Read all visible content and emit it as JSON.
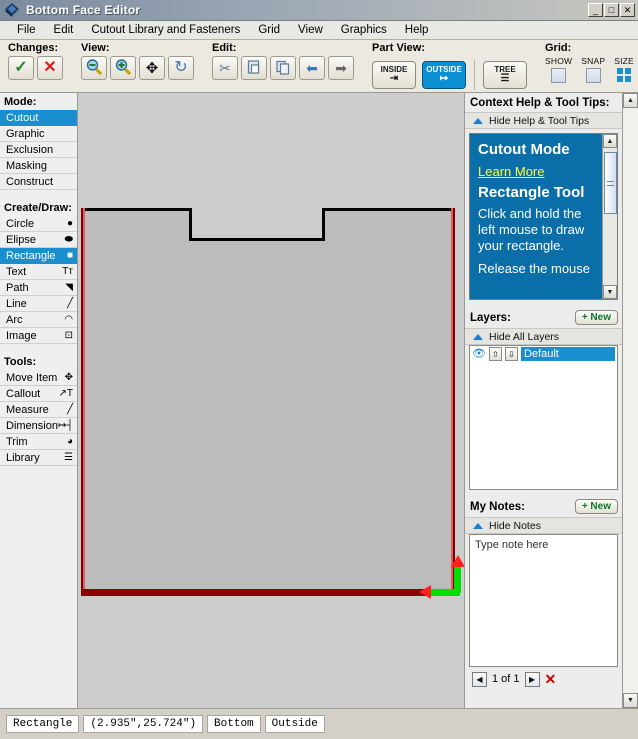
{
  "window": {
    "title": "Bottom Face Editor",
    "icon": "app-diamond-icon",
    "minimize": "_",
    "maximize": "□",
    "close": "✕"
  },
  "menubar": {
    "items": [
      {
        "label": "File"
      },
      {
        "label": "Edit"
      },
      {
        "label": "Cutout Library and Fasteners"
      },
      {
        "label": "Grid"
      },
      {
        "label": "View"
      },
      {
        "label": "Graphics"
      },
      {
        "label": "Help"
      }
    ]
  },
  "toolbar": {
    "changes": {
      "label": "Changes:",
      "accept": "✓",
      "reject": "✕"
    },
    "view": {
      "label": "View:",
      "zoom_out": "zoom-out-icon",
      "zoom_in": "zoom-in-icon",
      "pan": "✥",
      "refresh": "↻"
    },
    "edit": {
      "label": "Edit:",
      "cut": "✂",
      "paste": "paste-icon",
      "copy": "copy-icon",
      "undo": "⬅",
      "redo": "➡"
    },
    "part_view": {
      "label": "Part View:",
      "inside": "INSIDE",
      "inside_glyph": "⇥",
      "outside": "OUTSIDE",
      "outside_glyph": "↦",
      "active": "OUTSIDE",
      "tree": "TREE",
      "tree_glyph": "☰"
    },
    "grid": {
      "label": "Grid:",
      "show": "SHOW",
      "snap": "SNAP",
      "size": "SIZE",
      "show_checked": false,
      "snap_checked": false
    }
  },
  "left_panel": {
    "mode": {
      "label": "Mode:",
      "selected": "Cutout",
      "items": [
        {
          "label": "Cutout",
          "glyph": ""
        },
        {
          "label": "Graphic",
          "glyph": ""
        },
        {
          "label": "Exclusion",
          "glyph": ""
        },
        {
          "label": "Masking",
          "glyph": ""
        },
        {
          "label": "Construct",
          "glyph": ""
        }
      ]
    },
    "create_draw": {
      "label": "Create/Draw:",
      "selected": "Rectangle",
      "items": [
        {
          "label": "Circle",
          "glyph": "●"
        },
        {
          "label": "Elipse",
          "glyph": "⬬"
        },
        {
          "label": "Rectangle",
          "glyph": "■"
        },
        {
          "label": "Text",
          "glyph": "Tт"
        },
        {
          "label": "Path",
          "glyph": "◥"
        },
        {
          "label": "Line",
          "glyph": "╱"
        },
        {
          "label": "Arc",
          "glyph": "◠"
        },
        {
          "label": "Image",
          "glyph": "⊡"
        }
      ]
    },
    "tools": {
      "label": "Tools:",
      "items": [
        {
          "label": "Move Item",
          "glyph": "✥"
        },
        {
          "label": "Callout",
          "glyph": "↗T"
        },
        {
          "label": "Measure",
          "glyph": "╱"
        },
        {
          "label": "Dimension",
          "glyph": "↦┤"
        },
        {
          "label": "Trim",
          "glyph": "◕"
        },
        {
          "label": "Library",
          "glyph": "☰"
        }
      ]
    }
  },
  "help_panel": {
    "title": "Context Help & Tool Tips:",
    "toggle": "Hide Help & Tool Tips",
    "mode_heading": "Cutout Mode",
    "learn_more": "Learn More",
    "tool_heading": "Rectangle Tool",
    "paragraph1": "Click and hold the left mouse to draw your rectangle.",
    "paragraph2": "Release the mouse"
  },
  "layers_panel": {
    "title": "Layers:",
    "new_button": "+ New",
    "toggle": "Hide All Layers",
    "rows": [
      {
        "name": "Default",
        "visible_icon": "eye-icon",
        "up": "⇧",
        "down": "⇩",
        "selected": true
      }
    ]
  },
  "notes_panel": {
    "title": "My Notes:",
    "new_button": "+ New",
    "toggle": "Hide Notes",
    "placeholder": "Type note here",
    "value": "",
    "pager": {
      "prev": "◀",
      "label": "1 of 1",
      "next": "▶",
      "delete": "✕"
    }
  },
  "statusbar": {
    "tool": "Rectangle",
    "coordinates": "(2.935\",25.724\")",
    "face": "Bottom",
    "side": "Outside"
  },
  "canvas": {
    "shape_name": "bottom-face-part-outline",
    "selection_color": "#8b0000",
    "handle_color": "#00e000",
    "arrow_color": "#ff2020"
  },
  "colors": {
    "accent_blue": "#1a8fd0",
    "help_blue": "#0a6ea8",
    "link_yellow": "#ffff33",
    "new_green": "#0a7a2a"
  }
}
